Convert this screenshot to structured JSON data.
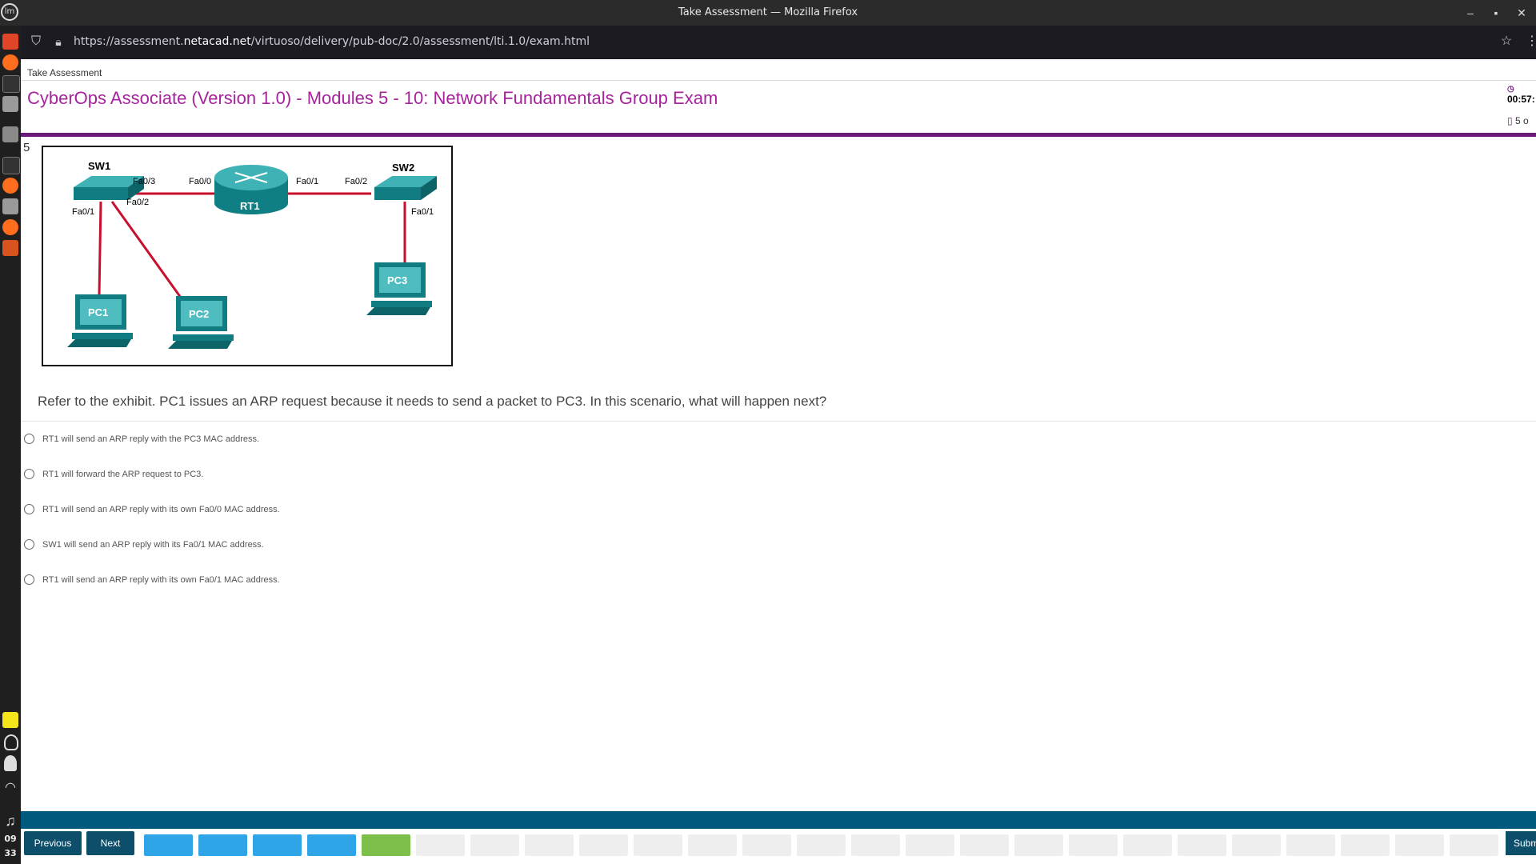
{
  "window": {
    "title": "Take Assessment — Mozilla Firefox"
  },
  "browser": {
    "url_prefix": "https://assessment.",
    "url_domain": "netacad.net",
    "url_suffix": "/virtuoso/delivery/pub-doc/2.0/assessment/lti.1.0/exam.html"
  },
  "dock": {
    "clock_hour": "09",
    "clock_min": "33",
    "logo": "lm"
  },
  "page": {
    "breadcrumb": "Take Assessment",
    "title": "CyberOps Associate (Version 1.0) - Modules 5 - 10: Network Fundamentals Group Exam",
    "timer": "00:57:",
    "page_count": "5 o"
  },
  "question": {
    "number": "5",
    "text": "Refer to the exhibit. PC1 issues an ARP request because it needs to send a packet to PC3. In this scenario, what will happen next?",
    "options": [
      "RT1 will send an ARP reply with the PC3 MAC address.",
      "RT1 will forward the ARP request to PC3.",
      "RT1 will send an ARP reply with its own Fa0/0 MAC address.",
      "SW1 will send an ARP reply with its Fa0/1 MAC address.",
      "RT1 will send an ARP reply with its own Fa0/1 MAC address."
    ]
  },
  "exhibit": {
    "sw1": "SW1",
    "sw2": "SW2",
    "rt1": "RT1",
    "pc1": "PC1",
    "pc2": "PC2",
    "pc3": "PC3",
    "sw1_fa03": "Fa0/3",
    "sw1_fa02": "Fa0/2",
    "sw1_fa01": "Fa0/1",
    "rt1_fa00": "Fa0/0",
    "rt1_fa01": "Fa0/1",
    "sw2_fa02": "Fa0/2",
    "sw2_fa01": "Fa0/1"
  },
  "footer": {
    "previous": "Previous",
    "next": "Next",
    "submit": "Submit",
    "answered_color": "#2fa4e7",
    "current_color": "#7cc04b",
    "unanswered_color": "#eeeeee",
    "question_states": [
      "answered",
      "answered",
      "answered",
      "answered",
      "current",
      "unanswered",
      "unanswered",
      "unanswered",
      "unanswered",
      "unanswered",
      "unanswered",
      "unanswered",
      "unanswered",
      "unanswered",
      "unanswered",
      "unanswered",
      "unanswered",
      "unanswered",
      "unanswered",
      "unanswered",
      "unanswered",
      "unanswered",
      "unanswered",
      "unanswered",
      "unanswered",
      "unanswered"
    ]
  }
}
